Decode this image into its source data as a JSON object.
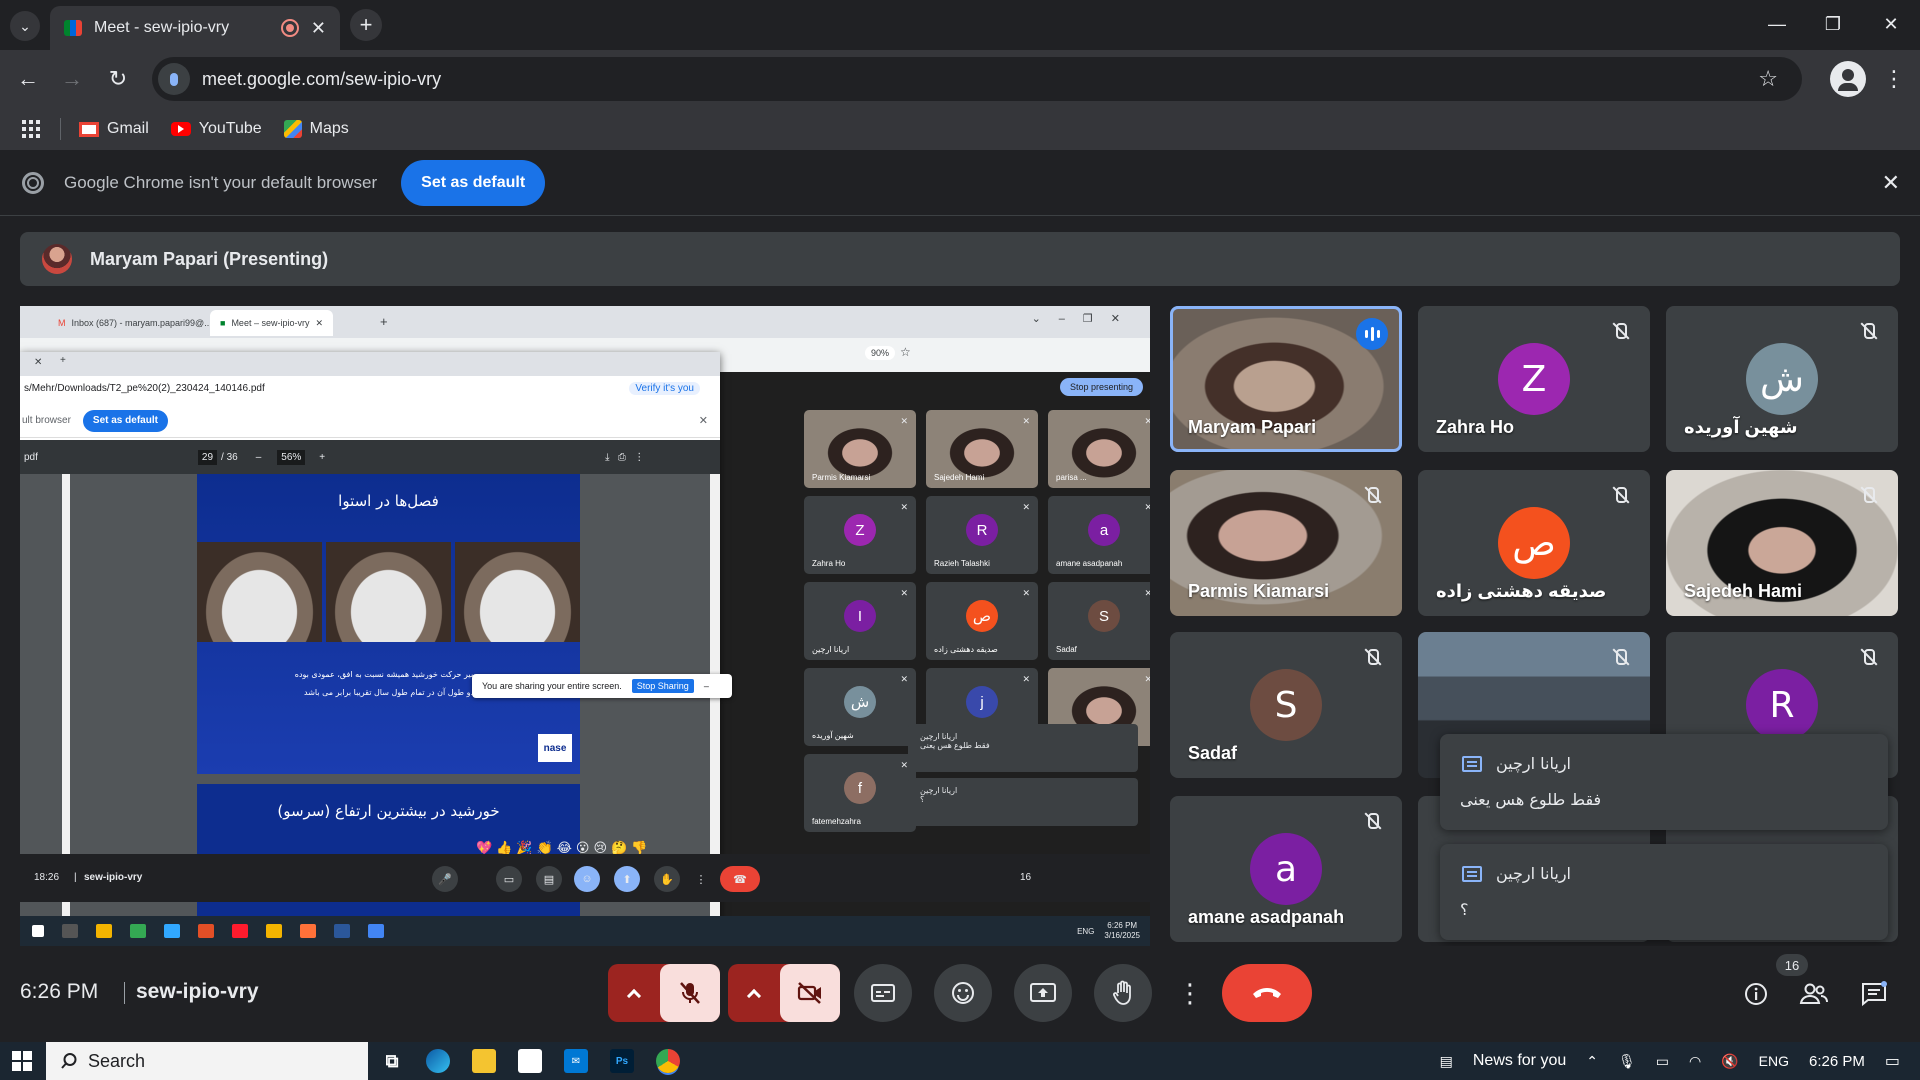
{
  "browser": {
    "tab_title": "Meet - sew-ipio-vry",
    "url": "meet.google.com/sew-ipio-vry",
    "bookmarks": [
      {
        "label": "Gmail"
      },
      {
        "label": "YouTube"
      },
      {
        "label": "Maps"
      }
    ],
    "default_bar": {
      "message": "Google Chrome isn't your default browser",
      "button": "Set as default"
    }
  },
  "meet": {
    "presenter_label": "Maryam Papari (Presenting)",
    "time": "6:26 PM",
    "meeting_code": "sew-ipio-vry",
    "participant_count": "16",
    "tiles": [
      {
        "name": "Maryam Papari",
        "initial": "",
        "speaking": true
      },
      {
        "name": "Zahra Ho",
        "initial": "Z",
        "color": "#9c27b0"
      },
      {
        "name": "شهین آوریده",
        "initial": "ش",
        "color": "#78909c"
      },
      {
        "name": "Parmis Kiamarsi",
        "initial": ""
      },
      {
        "name": "صدیقه دهشتی زاده",
        "initial": "ص",
        "color": "#f4511e"
      },
      {
        "name": "Sajedeh Hami",
        "initial": ""
      },
      {
        "name": "Sadaf",
        "initial": "S",
        "color": "#6d4c41"
      },
      {
        "name": "",
        "initial": ""
      },
      {
        "name": "",
        "initial": "R",
        "color": "#7b1fa2"
      },
      {
        "name": "amane asadpanah",
        "initial": "a",
        "color": "#7b1fa2"
      }
    ],
    "chats": [
      {
        "author": "اریانا ارچین",
        "message": "فقط طلوع هس یعنی"
      },
      {
        "author": "اریانا ارچین",
        "message": "؟"
      }
    ]
  },
  "shared_screen": {
    "tabs": [
      "Inbox (687) - maryam.papari99@...",
      "Meet – sew-ipio-vry"
    ],
    "zoom_outer": "90%",
    "share_notice": "You are sharing your entire screen.",
    "share_stop": "Stop Sharing",
    "verify": "Verify it's you",
    "pdf_path": "s/Mehr/Downloads/T2_pe%20(2)_230424_140146.pdf",
    "default_msg": "ult browser",
    "default_btn": "Set as default",
    "pdf_label": "pdf",
    "page": "29",
    "page_total": "/ 36",
    "zoom": "56%",
    "slide_title": "فصل‌ها در استوا",
    "slide_text_1": "مسیر حرکت خورشید همیشه نسبت به افق، عمودی بوده",
    "slide_text_2": "و طول آن در تمام طول سال تقریبا برابر می باشد.",
    "slide_logo": "nase",
    "slide2_title": "خورشید در بیشترین ارتفاع (سرسو)",
    "stop_presenting": "Stop presenting",
    "inner_tiles": [
      {
        "name": "Parmis Kiamarsi",
        "initial": ""
      },
      {
        "name": "Sajedeh Hami",
        "initial": ""
      },
      {
        "name": "parisa ...",
        "initial": ""
      },
      {
        "name": "Zahra Ho",
        "initial": "Z",
        "color": "#9c27b0"
      },
      {
        "name": "Razieh Talashki",
        "initial": "R",
        "color": "#7b1fa2"
      },
      {
        "name": "amane asadpanah",
        "initial": "a",
        "color": "#7b1fa2"
      },
      {
        "name": "اریانا ارچین",
        "initial": "I",
        "color": "#7b1fa2"
      },
      {
        "name": "صدیقه دهشتی زاده",
        "initial": "ص",
        "color": "#f4511e"
      },
      {
        "name": "Sadaf",
        "initial": "S",
        "color": "#6d4c41"
      },
      {
        "name": "شهین آوریده",
        "initial": "ش",
        "color": "#78909c"
      },
      {
        "name": "",
        "initial": "j",
        "color": "#3949ab"
      },
      {
        "name": "",
        "initial": ""
      },
      {
        "name": "fatemehzahra",
        "initial": "f",
        "color": "#8d6e63"
      }
    ],
    "inner_chats": [
      {
        "author": "اریانا ارچین",
        "message": "فقط طلوع هس یعنی"
      },
      {
        "author": "اریانا ارچین",
        "message": "؟"
      }
    ],
    "reactions": "💖👍🎉👏😂😮😢🤔👎",
    "inner_time": "18:26",
    "inner_code": "sew-ipio-vry",
    "inner_badge": "16",
    "inner_clock": "6:26 PM",
    "inner_date": "3/16/2025",
    "inner_lang": "ENG"
  },
  "taskbar": {
    "search": "Search",
    "news": "News for you",
    "lang": "ENG",
    "time": "6:26 PM"
  },
  "colors": {
    "accent": "#1a73e8",
    "danger": "#ea4335",
    "meet_bg": "#202124",
    "tile_bg": "#3c4043"
  }
}
